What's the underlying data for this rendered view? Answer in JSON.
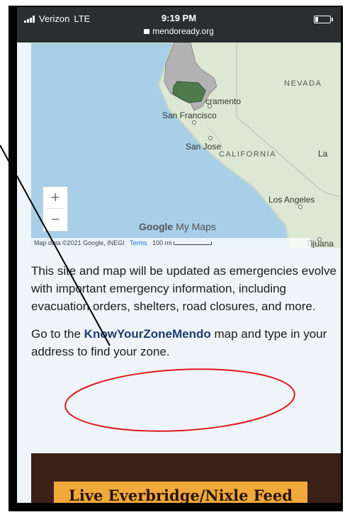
{
  "status_bar": {
    "carrier": "Verizon",
    "network": "LTE",
    "time": "9:19 PM",
    "url": "mendoready.org"
  },
  "map": {
    "labels": {
      "nevada": "NEVADA",
      "sacramento": "cramento",
      "san_francisco": "San Francisco",
      "san_jose": "San Jose",
      "california": "CALIFORNIA",
      "la_partial": "La",
      "los_angeles": "Los Angeles",
      "tijuana": "Tijuana"
    },
    "zoom_in": "+",
    "zoom_out": "−",
    "logo_google": "Google",
    "logo_mymaps": "My Maps",
    "attribution": "Map data ©2021 Google, INEGI",
    "terms": "Terms",
    "scale": "100 mi"
  },
  "content": {
    "paragraph1": "This site and map will be updated as emergencies evolve with important emergency information, including evacuation orders, shelters, road closures, and more.",
    "paragraph2_prefix": "Go to the ",
    "paragraph2_link": "KnowYourZoneMendo",
    "paragraph2_suffix": " map and type in your address to find your zone."
  },
  "footer": {
    "button_label": "Live Everbridge/Nixle Feed"
  },
  "colors": {
    "link": "#1e3a6e",
    "footer_bg": "#3b2118",
    "button_bg": "#f2a93b",
    "annotation_red": "#e01a1a",
    "highlight_county": "#4e7a4e"
  }
}
